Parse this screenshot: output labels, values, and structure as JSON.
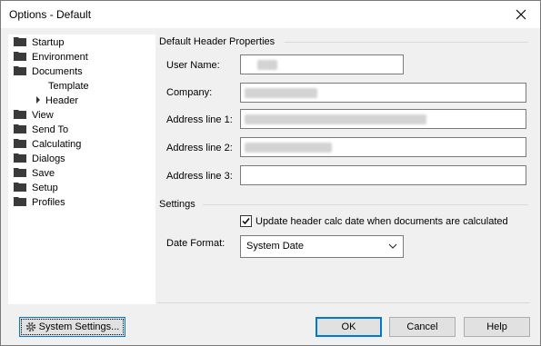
{
  "window": {
    "title": "Options - Default"
  },
  "sidebar": {
    "items": [
      {
        "label": "Startup"
      },
      {
        "label": "Environment"
      },
      {
        "label": "Documents"
      },
      {
        "label": "Template"
      },
      {
        "label": "Header"
      },
      {
        "label": "View"
      },
      {
        "label": "Send To"
      },
      {
        "label": "Calculating"
      },
      {
        "label": "Dialogs"
      },
      {
        "label": "Save"
      },
      {
        "label": "Setup"
      },
      {
        "label": "Profiles"
      }
    ]
  },
  "header_props": {
    "group_title": "Default Header Properties",
    "user_name_label": "User Name:",
    "company_label": "Company:",
    "address1_label": "Address line 1:",
    "address2_label": "Address line 2:",
    "address3_label": "Address line 3:"
  },
  "settings": {
    "group_title": "Settings",
    "update_calc_date_label": "Update header calc date when documents are calculated",
    "update_calc_date_checked": true,
    "date_format_label": "Date Format:",
    "date_format_value": "System Date"
  },
  "buttons": {
    "system_settings": "System Settings...",
    "ok": "OK",
    "cancel": "Cancel",
    "help": "Help"
  },
  "colors": {
    "accent": "#0078d7",
    "folder": "#3a3a3a"
  }
}
